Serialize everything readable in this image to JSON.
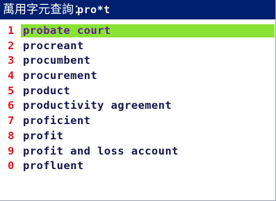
{
  "titlebar": {
    "label": "萬用字元查詢：",
    "query": "pro*t"
  },
  "results": [
    {
      "num": "1",
      "word": "probate court"
    },
    {
      "num": "2",
      "word": "procreant"
    },
    {
      "num": "3",
      "word": "procumbent"
    },
    {
      "num": "4",
      "word": "procurement"
    },
    {
      "num": "5",
      "word": "product"
    },
    {
      "num": "6",
      "word": "productivity agreement"
    },
    {
      "num": "7",
      "word": "proficient"
    },
    {
      "num": "8",
      "word": "profit"
    },
    {
      "num": "9",
      "word": "profit and loss account"
    },
    {
      "num": "0",
      "word": "profluent"
    }
  ],
  "selected_index": 0,
  "colors": {
    "titlebar_bg": "#001f6f",
    "highlight": "#88e335",
    "number": "#e0141e",
    "text": "#14144a",
    "selected_text": "#6a1a9c"
  }
}
